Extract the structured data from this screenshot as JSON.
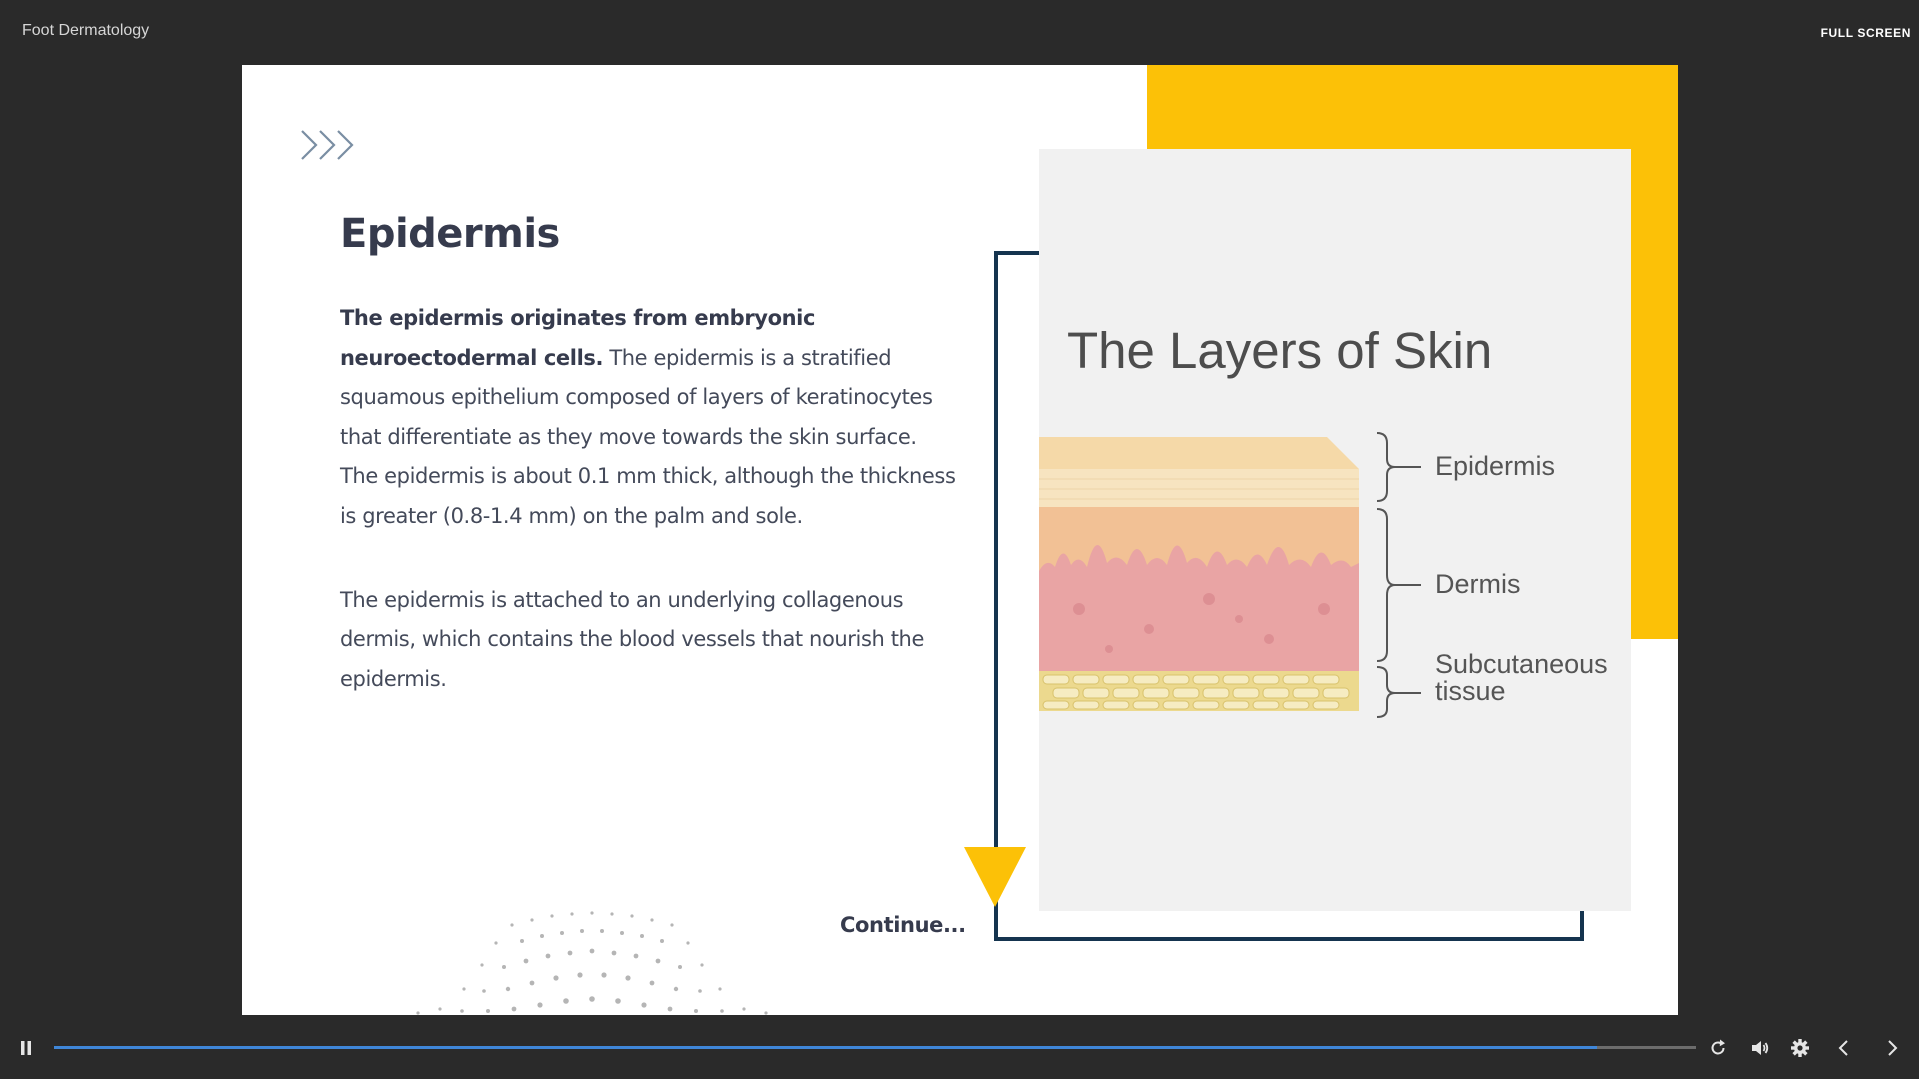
{
  "header": {
    "course_title": "Foot Dermatology",
    "fullscreen_label": "FULL SCREEN"
  },
  "slide": {
    "title": "Epidermis",
    "paragraph1_bold": "The epidermis originates from embryonic neuroectodermal cells.",
    "paragraph1_rest": " The epidermis is a stratified squamous epithelium composed of layers of keratinocytes that differentiate as they move towards the skin surface. The epidermis is about 0.1 mm thick, although the thickness is greater (0.8-1.4 mm) on the palm and sole.",
    "paragraph2": "The epidermis is attached to an underlying collagenous dermis, which contains the blood vessels that nourish the epidermis.",
    "continue_label": "Continue..."
  },
  "image": {
    "title": "The Layers of Skin",
    "labels": {
      "epidermis": "Epidermis",
      "dermis": "Dermis",
      "subcutaneous_line1": "Subcutaneous",
      "subcutaneous_line2": "tissue"
    }
  },
  "colors": {
    "accent_yellow": "#fcc107",
    "navy": "#15344f",
    "title_text": "#363b4d",
    "progress_blue": "#3f86d8"
  },
  "player": {
    "progress_percent": 94,
    "icons": [
      "pause-icon",
      "replay-icon",
      "volume-icon",
      "settings-icon",
      "previous-icon",
      "next-icon"
    ]
  }
}
